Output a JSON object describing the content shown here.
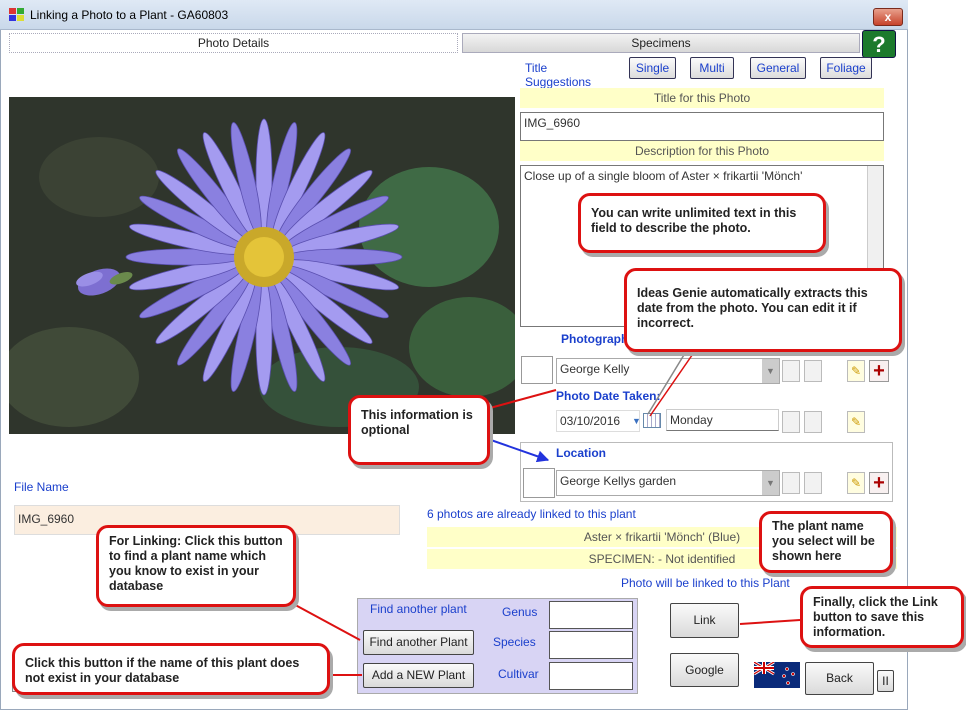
{
  "window": {
    "title": "Linking a Photo to a Plant - GA60803",
    "close_label": "x"
  },
  "tabs": {
    "photo_details": "Photo Details",
    "specimens": "Specimens",
    "help": "?"
  },
  "title_suggestions": {
    "label": "Title Suggestions",
    "buttons": [
      "Single",
      "Multi",
      "General",
      "Foliage"
    ]
  },
  "title_band": "Title for this Photo",
  "title_value": "IMG_6960",
  "description_band": "Description for this Photo",
  "description_value": "Close up of a single bloom of Aster × frikartii 'Mönch'",
  "photographer": {
    "label": "Photographer",
    "value": "George Kelly"
  },
  "date": {
    "label": "Photo Date Taken:",
    "value": "03/10/2016",
    "day": "Monday"
  },
  "location": {
    "label": "Location",
    "value": "George Kellys garden"
  },
  "file_name": {
    "label": "File Name",
    "value": "IMG_6960"
  },
  "linked_info": "6 photos are already linked to this plant",
  "plant_name": "Aster × frikartii 'Mönch' (Blue)",
  "specimen": "SPECIMEN: - Not identified",
  "will_link": "Photo will be linked to this Plant",
  "find_panel": {
    "heading": "Find another plant",
    "find_button": "Find another Plant",
    "add_button": "Add a NEW Plant",
    "genus": "Genus",
    "species": "Species",
    "cultivar": "Cultivar"
  },
  "buttons": {
    "link": "Link",
    "google": "Google",
    "back": "Back",
    "pause": "II"
  },
  "callouts": {
    "describe": "You can write unlimited text in this field to describe the photo.",
    "date": "Ideas Genie automatically extracts this date from the photo. You can edit it if incorrect.",
    "optional": "This information is optional",
    "plantname": "The plant name you select will be shown here",
    "linking": "For Linking: Click this button to find a plant name which you know to exist in your database",
    "newplant": "Click this button if the name of this plant does not exist in your database",
    "finally": "Finally, click the Link button to save this information."
  },
  "colors": {
    "accent": "#1a3fcc",
    "callout_border": "#dd1111",
    "band": "#ffffc8",
    "panel": "#d8d4f4"
  }
}
